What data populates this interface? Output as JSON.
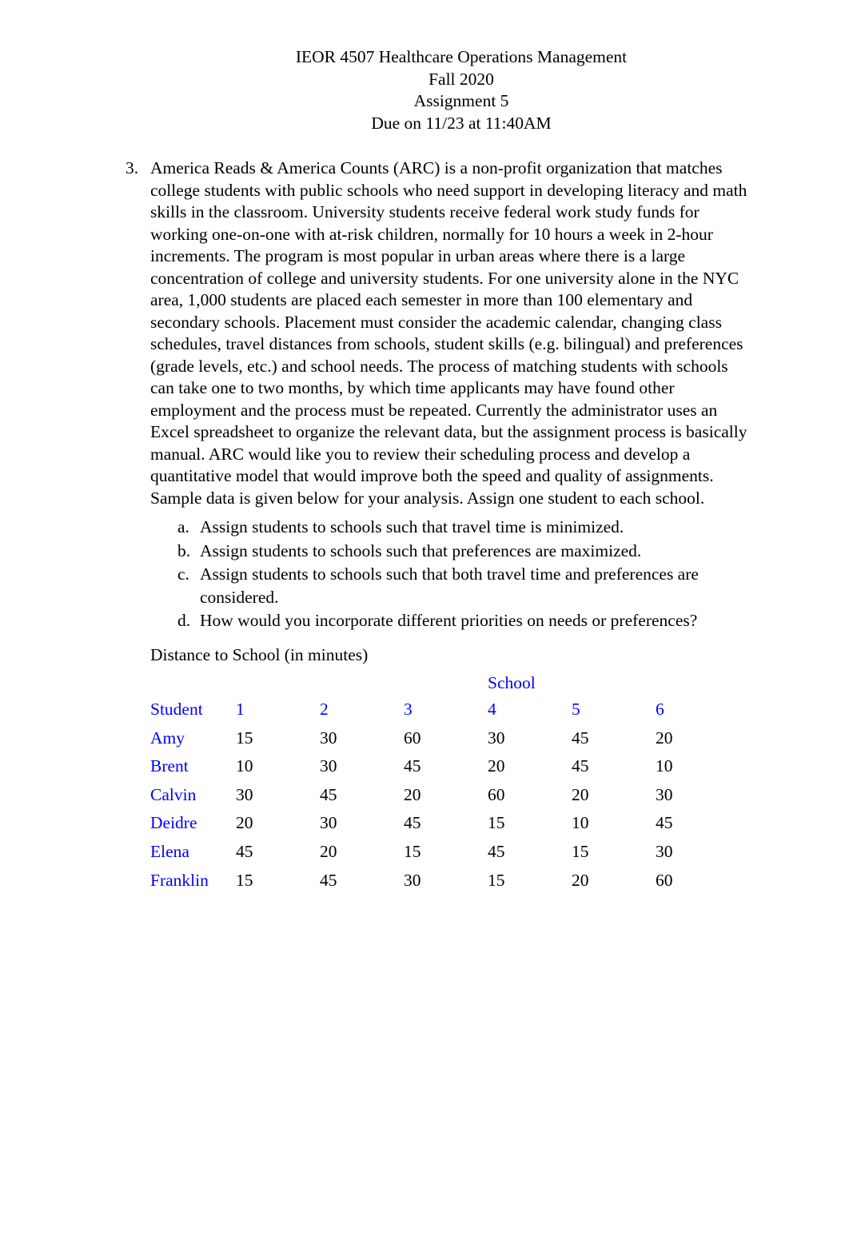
{
  "header": {
    "lines": [
      "IEOR 4507 Healthcare Operations Management",
      "Fall 2020",
      "Assignment 5",
      "Due on 11/23 at 11:40AM"
    ]
  },
  "problem": {
    "number": "3.",
    "text": "America Reads & America Counts (ARC) is a non-profit organization that matches college students with public schools who need support in developing literacy and math skills in the classroom. University students receive federal work study funds for working one-on-one with at-risk children, normally for 10 hours a week in 2-hour increments. The program is most popular in urban areas where there is a large concentration of college and university students. For one university alone in the NYC area, 1,000 students are placed each semester in more than 100 elementary and secondary schools. Placement must consider the academic calendar, changing class schedules, travel distances from schools, student skills (e.g. bilingual) and preferences (grade levels, etc.) and school needs. The process of matching students with schools can take one to two months, by which time applicants may have found other employment and the process must be repeated. Currently the administrator uses an Excel spreadsheet to organize the relevant data, but the assignment process is basically manual. ARC would like you to review their scheduling process and develop a quantitative model that would improve both the speed and quality of assignments. Sample data is given below for your analysis. Assign one student to each school.",
    "subitems": [
      {
        "marker": "a.",
        "text": "Assign students to schools such that travel time is minimized."
      },
      {
        "marker": "b.",
        "text": "Assign students to schools such that preferences are maximized."
      },
      {
        "marker": "c.",
        "text": "Assign students to schools such that both travel time and preferences are considered."
      },
      {
        "marker": "d.",
        "text": "How would you incorporate different priorities on needs or preferences?"
      }
    ]
  },
  "table": {
    "caption": "Distance to School (in minutes)",
    "group_header": "School",
    "row_header_label": "Student",
    "column_headers": [
      "1",
      "2",
      "3",
      "4",
      "5",
      "6"
    ],
    "rows": [
      {
        "student": "Amy",
        "values": [
          "15",
          "30",
          "60",
          "30",
          "45",
          "20"
        ]
      },
      {
        "student": "Brent",
        "values": [
          "10",
          "30",
          "45",
          "20",
          "45",
          "10"
        ]
      },
      {
        "student": "Calvin",
        "values": [
          "30",
          "45",
          "20",
          "60",
          "20",
          "30"
        ]
      },
      {
        "student": "Deidre",
        "values": [
          "20",
          "30",
          "45",
          "15",
          "10",
          "45"
        ]
      },
      {
        "student": "Elena",
        "values": [
          "45",
          "20",
          "15",
          "45",
          "15",
          "30"
        ]
      },
      {
        "student": "Franklin",
        "values": [
          "15",
          "45",
          "30",
          "15",
          "20",
          "60"
        ]
      }
    ]
  },
  "colors": {
    "header_blue": "#0000FF",
    "body_black": "#000000",
    "page_background": "#FFFFFF"
  }
}
